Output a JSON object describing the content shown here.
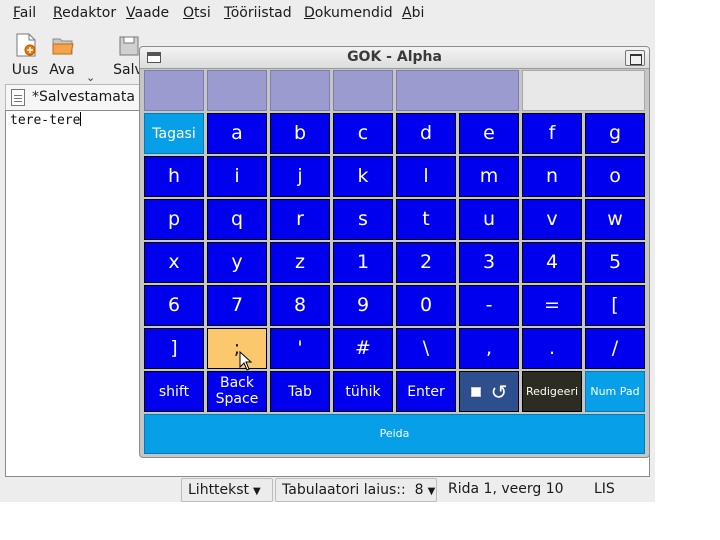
{
  "menu": [
    {
      "label": "Fail",
      "accel": "F",
      "rest": "ail"
    },
    {
      "label": "Redaktor",
      "accel": "R",
      "rest": "edaktor"
    },
    {
      "label": "Vaade",
      "accel": "V",
      "rest": "aade"
    },
    {
      "label": "Otsi",
      "accel": "O",
      "rest": "tsi"
    },
    {
      "label": "Tööriistad",
      "accel": "T",
      "rest": "ööriistad"
    },
    {
      "label": "Dokumendid",
      "accel": "D",
      "rest": "okumendid"
    },
    {
      "label": "Abi",
      "accel": "A",
      "rest": "bi"
    }
  ],
  "toolbar": {
    "new_label": "Uus",
    "open_label": "Ava",
    "save_label": "Salv"
  },
  "tab": {
    "title": "*Salvestamata d"
  },
  "editor": {
    "text": "tere-tere"
  },
  "statusbar": {
    "language": "Lihttekst",
    "tab_width_label": "Tabulaatori laius::",
    "tab_width_value": "8",
    "position": "Rida 1, veerg 10",
    "mode": "LIS"
  },
  "gok": {
    "title": "GOK - Alpha",
    "rows": [
      [
        "Tagasi",
        "a",
        "b",
        "c",
        "d",
        "e",
        "f",
        "g"
      ],
      [
        "h",
        "i",
        "j",
        "k",
        "l",
        "m",
        "n",
        "o"
      ],
      [
        "p",
        "q",
        "r",
        "s",
        "t",
        "u",
        "v",
        "w"
      ],
      [
        "x",
        "y",
        "z",
        "1",
        "2",
        "3",
        "4",
        "5"
      ],
      [
        "6",
        "7",
        "8",
        "9",
        "0",
        "-",
        "=",
        "["
      ],
      [
        "]",
        ";",
        "'",
        "#",
        "\\",
        ",",
        ".",
        "/"
      ]
    ],
    "bottom_row": {
      "shift": "shift",
      "backspace": "Back Space",
      "tab": "Tab",
      "space": "tühik",
      "enter": "Enter",
      "edit": "Redigeeri",
      "numpad": "Num Pad"
    },
    "hide": "Peida",
    "highlighted_key": ";",
    "colors": {
      "key": "#0000ee",
      "key_top": "#9b9bd0",
      "key_back": "#07a0e8",
      "key_hover": "#fbc86e",
      "key_edit": "#2c2c22"
    }
  }
}
